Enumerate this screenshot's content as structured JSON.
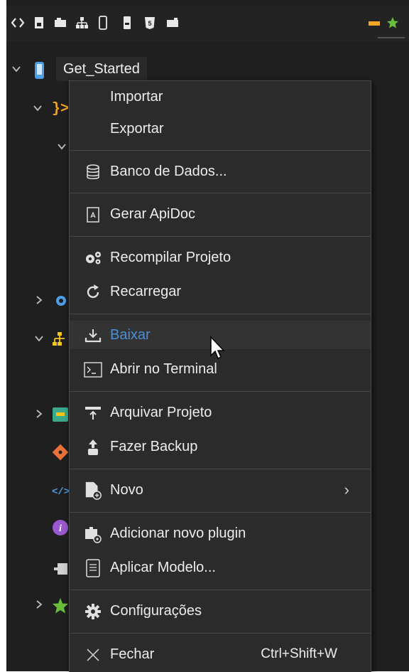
{
  "toolbar": {
    "icons": [
      "code-icon",
      "document-icon",
      "database-icon",
      "sitemap-icon",
      "mobile-icon",
      "server-icon",
      "html5-icon",
      "package-icon",
      "minimize-icon",
      "star-icon"
    ]
  },
  "tree": {
    "root_label": "Get_Started",
    "rows": [
      {
        "icon": "mobile-icon"
      },
      {
        "icon": "braces-icon"
      },
      {
        "icon": "chevron-icon"
      },
      {
        "icon": "gear-icon"
      },
      {
        "icon": "sitemap-icon"
      },
      {
        "icon": "module-icon"
      },
      {
        "icon": "git-icon"
      },
      {
        "icon": "code-icon"
      },
      {
        "icon": "info-icon"
      },
      {
        "icon": "plugin-icon"
      },
      {
        "icon": "star-icon"
      }
    ]
  },
  "menu": {
    "items": [
      {
        "id": "importar",
        "label": "Importar",
        "icon": ""
      },
      {
        "id": "exportar",
        "label": "Exportar",
        "icon": ""
      },
      {
        "id": "banco",
        "label": "Banco de Dados...",
        "icon": "database-icon"
      },
      {
        "id": "apidoc",
        "label": "Gerar ApiDoc",
        "icon": "apidoc-icon"
      },
      {
        "id": "recompilar",
        "label": "Recompilar Projeto",
        "icon": "gears-icon"
      },
      {
        "id": "recarregar",
        "label": "Recarregar",
        "icon": "reload-icon"
      },
      {
        "id": "baixar",
        "label": "Baixar",
        "icon": "download-icon"
      },
      {
        "id": "terminal",
        "label": "Abrir no Terminal",
        "icon": "terminal-icon"
      },
      {
        "id": "arquivar",
        "label": "Arquivar Projeto",
        "icon": "archive-icon"
      },
      {
        "id": "backup",
        "label": "Fazer Backup",
        "icon": "backup-icon"
      },
      {
        "id": "novo",
        "label": "Novo",
        "icon": "new-file-icon",
        "submenu": true
      },
      {
        "id": "plugin",
        "label": "Adicionar novo plugin",
        "icon": "plugin-icon"
      },
      {
        "id": "modelo",
        "label": "Aplicar Modelo...",
        "icon": "template-icon"
      },
      {
        "id": "config",
        "label": "Configurações",
        "icon": "gear-icon"
      },
      {
        "id": "fechar",
        "label": "Fechar",
        "icon": "close-icon",
        "shortcut": "Ctrl+Shift+W"
      }
    ],
    "hovered": "Baixar",
    "submenu_arrow": "›"
  },
  "colors": {
    "background": "#1f1f1f",
    "menu_background": "#2b2b2b",
    "hover_text": "#4a90d9",
    "accent_orange": "#f5a623",
    "accent_green": "#6abf3a"
  }
}
